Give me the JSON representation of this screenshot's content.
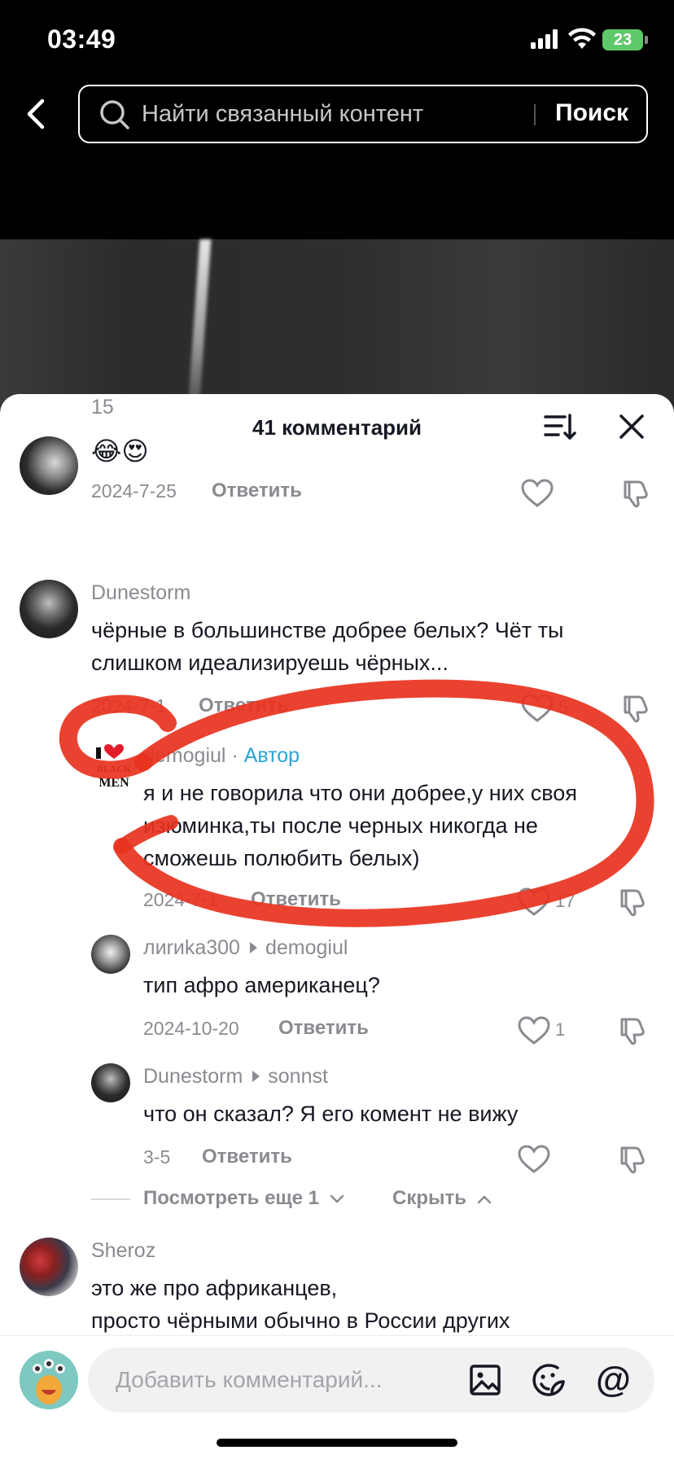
{
  "status_bar": {
    "time": "03:49",
    "battery": "23"
  },
  "search": {
    "placeholder": "Найти связанный контент",
    "submit_label": "Поиск"
  },
  "panel": {
    "title": "41 комментарий"
  },
  "comments": [
    {
      "id": "c0",
      "likes_username": "15",
      "text": "😂😍",
      "date": "2024-7-25",
      "reply_label": "Ответить",
      "likes": ""
    },
    {
      "id": "c1",
      "username": "Dunestorm",
      "text_lines": [
        "чёрные в большинстве добрее белых? Чёт ты",
        "слишком идеализируешь чёрных..."
      ],
      "date": "2024-7-1",
      "reply_label": "Ответить",
      "likes": "5"
    },
    {
      "id": "r1",
      "username": "demogiul",
      "author_badge": "Автор",
      "avatar_text_1": "BLACK",
      "avatar_text_2": "MEN",
      "text_lines": [
        "я и не говорила что они добрее,у них своя",
        "изюминка,ты после черных никогда не",
        "сможешь полюбить белых)"
      ],
      "date": "2024-7-1",
      "reply_label": "Ответить",
      "likes": "17"
    },
    {
      "id": "r2",
      "username": "лиrиka300",
      "reply_to": "demogiul",
      "text": "тип афро американец?",
      "date": "2024-10-20",
      "reply_label": "Ответить",
      "likes": "1"
    },
    {
      "id": "r3",
      "username": "Dunestorm",
      "reply_to": "sonnst",
      "text": "что он сказал? Я его комент не вижу",
      "date": "3-5",
      "reply_label": "Ответить",
      "likes": ""
    },
    {
      "id": "c2",
      "username": "Sheroz",
      "text_lines": [
        "это же про африканцев,",
        "просто чёрными обычно в России других"
      ]
    }
  ],
  "thread_controls": {
    "more_label": "Посмотреть еще 1",
    "hide_label": "Скрыть"
  },
  "composer": {
    "placeholder": "Добавить комментарий...",
    "mention": "@"
  },
  "colors": {
    "author_badge": "#2aa3d9",
    "annotation": "#e8321e",
    "battery": "#5ec96a"
  }
}
